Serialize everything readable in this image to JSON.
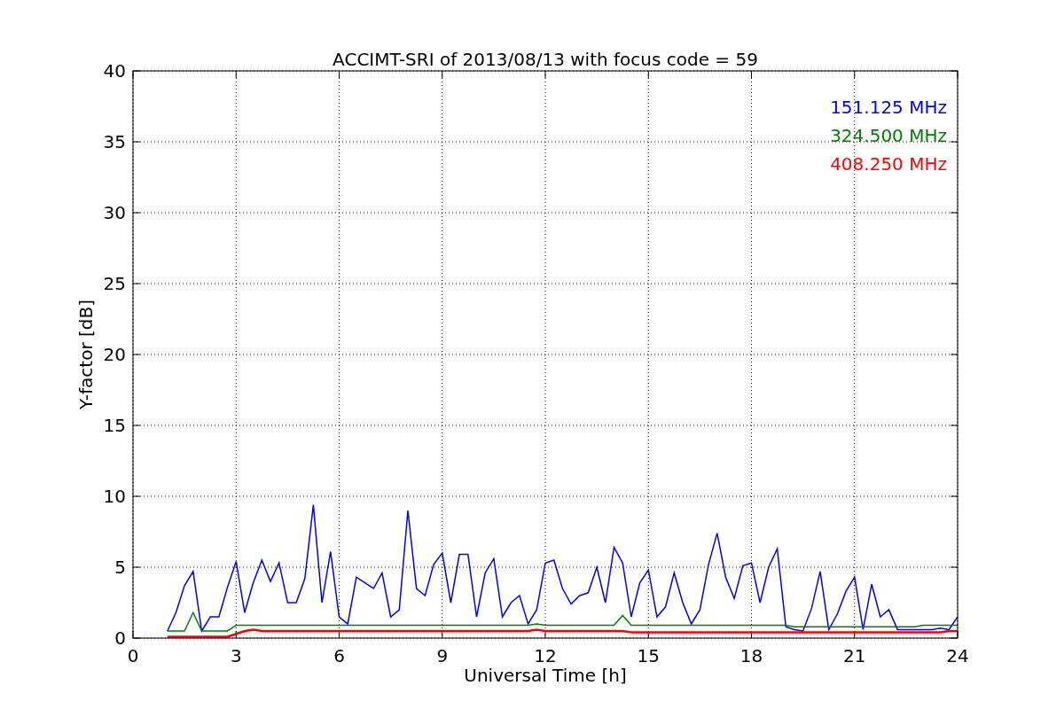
{
  "chart_data": {
    "type": "line",
    "title": "ACCIMT-SRI of 2013/08/13 with focus code = 59",
    "xlabel": "Universal Time [h]",
    "ylabel": "Y-factor [dB]",
    "x": [
      1,
      1.25,
      1.5,
      1.75,
      2,
      2.25,
      2.5,
      2.75,
      3,
      3.25,
      3.5,
      3.75,
      4,
      4.25,
      4.5,
      4.75,
      5,
      5.25,
      5.5,
      5.75,
      6,
      6.25,
      6.5,
      6.75,
      7,
      7.25,
      7.5,
      7.75,
      8,
      8.25,
      8.5,
      8.75,
      9,
      9.25,
      9.5,
      9.75,
      10,
      10.25,
      10.5,
      10.75,
      11,
      11.25,
      11.5,
      11.75,
      12,
      12.25,
      12.5,
      12.75,
      13,
      13.25,
      13.5,
      13.75,
      14,
      14.25,
      14.5,
      14.75,
      15,
      15.25,
      15.5,
      15.75,
      16,
      16.25,
      16.5,
      16.75,
      17,
      17.25,
      17.5,
      17.75,
      18,
      18.25,
      18.5,
      18.75,
      19,
      19.25,
      19.5,
      19.75,
      20,
      20.25,
      20.5,
      20.75,
      21,
      21.25,
      21.5,
      21.75,
      22,
      22.25,
      22.5,
      22.75,
      23,
      23.25,
      23.5,
      23.75,
      24
    ],
    "series": [
      {
        "name": "151.125 MHz",
        "color": "#0000ff",
        "values": [
          0.5,
          1.8,
          3.7,
          4.7,
          0.5,
          1.5,
          1.5,
          3.6,
          5.4,
          1.8,
          3.9,
          5.5,
          4.0,
          5.3,
          2.5,
          2.5,
          4.2,
          9.4,
          2.5,
          6.1,
          1.5,
          1.0,
          4.3,
          3.9,
          3.5,
          4.6,
          1.5,
          2.0,
          9.0,
          3.5,
          3.0,
          5.2,
          6.0,
          2.5,
          5.9,
          5.9,
          1.5,
          4.6,
          5.6,
          1.5,
          2.5,
          3.0,
          1.0,
          2.0,
          5.3,
          5.5,
          3.5,
          2.4,
          3.0,
          3.2,
          5.0,
          2.5,
          6.4,
          5.3,
          1.5,
          3.9,
          4.8,
          1.5,
          2.2,
          4.6,
          2.5,
          1.0,
          2.0,
          5.2,
          7.4,
          4.3,
          2.8,
          5.1,
          5.3,
          2.5,
          5.0,
          6.3,
          0.8,
          0.6,
          0.5,
          2.1,
          4.7,
          0.6,
          1.7,
          3.3,
          4.3,
          0.6,
          3.8,
          1.5,
          2.0,
          0.6,
          0.6,
          0.6,
          0.6,
          0.6,
          0.7,
          0.6,
          1.5
        ]
      },
      {
        "name": "324.500 MHz",
        "color": "#008000",
        "values": [
          0.5,
          0.5,
          0.5,
          1.8,
          0.5,
          0.5,
          0.5,
          0.5,
          0.9,
          0.9,
          0.9,
          0.9,
          0.9,
          0.9,
          0.9,
          0.9,
          0.9,
          0.9,
          0.9,
          0.9,
          0.9,
          0.9,
          0.9,
          0.9,
          0.9,
          0.9,
          0.9,
          0.9,
          0.9,
          0.9,
          0.9,
          0.9,
          0.9,
          0.9,
          0.9,
          0.9,
          0.9,
          0.9,
          0.9,
          0.9,
          0.9,
          0.9,
          0.9,
          1.0,
          0.9,
          0.9,
          0.9,
          0.9,
          0.9,
          0.9,
          0.9,
          0.9,
          0.9,
          1.6,
          0.9,
          0.9,
          0.9,
          0.9,
          0.9,
          0.9,
          0.9,
          0.9,
          0.9,
          0.9,
          0.9,
          0.9,
          0.9,
          0.9,
          0.9,
          0.9,
          0.9,
          0.9,
          0.9,
          0.8,
          0.8,
          0.8,
          0.8,
          0.8,
          0.8,
          0.8,
          0.8,
          0.8,
          0.8,
          0.8,
          0.8,
          0.8,
          0.8,
          0.8,
          0.9,
          0.9,
          0.9,
          0.9,
          0.9
        ]
      },
      {
        "name": "408.250 MHz",
        "color": "#ff0000",
        "values": [
          0.1,
          0.1,
          0.1,
          0.1,
          0.1,
          0.1,
          0.1,
          0.1,
          0.3,
          0.5,
          0.6,
          0.5,
          0.5,
          0.5,
          0.5,
          0.5,
          0.5,
          0.5,
          0.5,
          0.5,
          0.5,
          0.5,
          0.5,
          0.5,
          0.5,
          0.5,
          0.5,
          0.5,
          0.5,
          0.5,
          0.5,
          0.5,
          0.5,
          0.5,
          0.5,
          0.5,
          0.5,
          0.5,
          0.5,
          0.5,
          0.5,
          0.5,
          0.5,
          0.6,
          0.5,
          0.5,
          0.5,
          0.5,
          0.5,
          0.5,
          0.5,
          0.5,
          0.5,
          0.5,
          0.4,
          0.4,
          0.4,
          0.4,
          0.4,
          0.4,
          0.4,
          0.4,
          0.4,
          0.4,
          0.4,
          0.4,
          0.4,
          0.4,
          0.4,
          0.4,
          0.4,
          0.4,
          0.4,
          0.4,
          0.4,
          0.4,
          0.4,
          0.4,
          0.4,
          0.4,
          0.4,
          0.4,
          0.4,
          0.4,
          0.4,
          0.4,
          0.4,
          0.4,
          0.4,
          0.4,
          0.4,
          0.5,
          0.5
        ]
      }
    ],
    "grid": true,
    "xlim": [
      0,
      24
    ],
    "ylim": [
      0,
      40
    ],
    "xticks": [
      0,
      3,
      6,
      9,
      12,
      15,
      18,
      21,
      24
    ],
    "yticks": [
      0,
      5,
      10,
      15,
      20,
      25,
      30,
      35,
      40
    ]
  }
}
